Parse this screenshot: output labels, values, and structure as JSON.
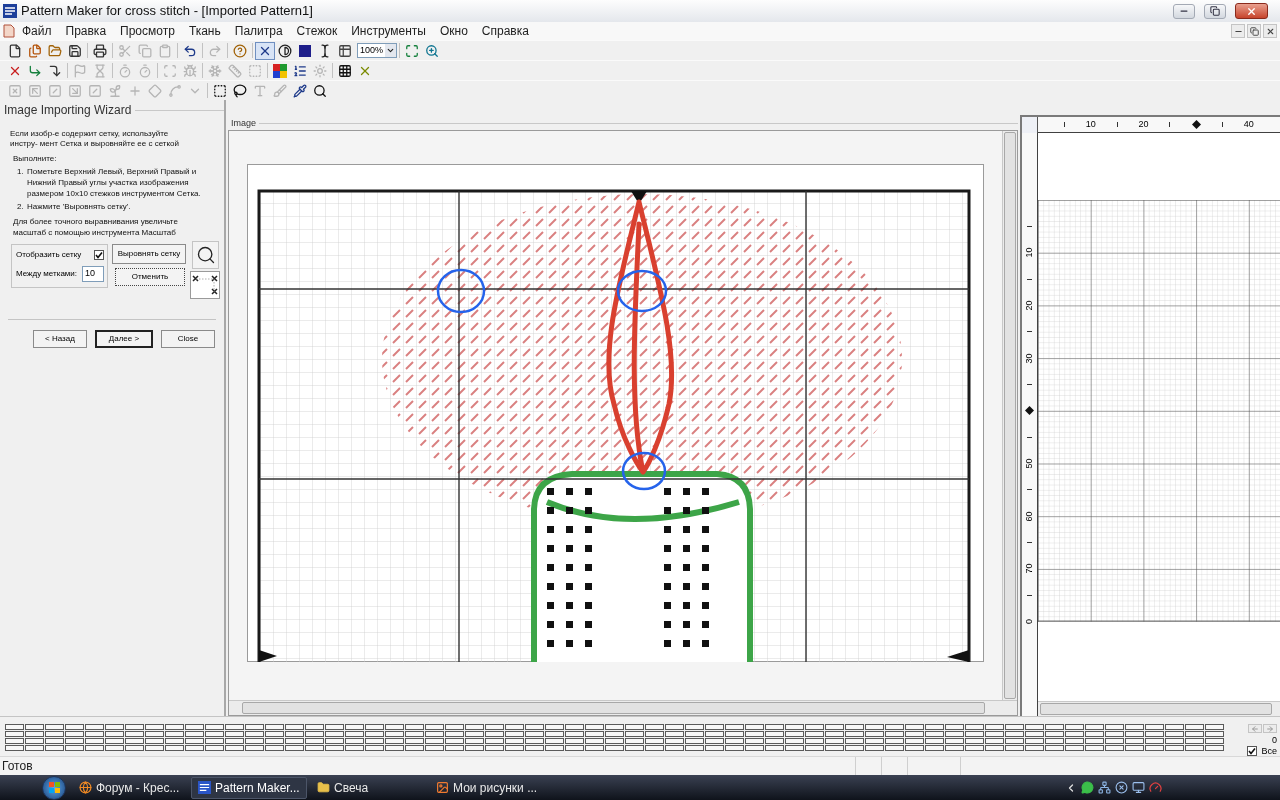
{
  "window": {
    "title": "Pattern Maker for cross stitch - [Imported Pattern1]"
  },
  "menu": [
    "Файл",
    "Правка",
    "Просмотр",
    "Ткань",
    "Палитра",
    "Стежок",
    "Инструменты",
    "Окно",
    "Справка"
  ],
  "toolbars": [
    {
      "groups": [
        [
          {
            "kind": "button",
            "disabled": false,
            "pressed": false
          },
          {
            "kind": "button",
            "disabled": false,
            "pressed": false
          },
          {
            "kind": "button",
            "disabled": false,
            "pressed": false
          },
          {
            "kind": "button",
            "disabled": false,
            "pressed": false
          }
        ],
        [
          {
            "kind": "button",
            "disabled": false,
            "pressed": false
          }
        ],
        [
          {
            "kind": "button",
            "disabled": true,
            "pressed": false
          },
          {
            "kind": "button",
            "disabled": true,
            "pressed": false
          },
          {
            "kind": "button",
            "disabled": true,
            "pressed": false
          }
        ],
        [
          {
            "kind": "button",
            "disabled": false,
            "pressed": false
          }
        ],
        [
          {
            "kind": "button",
            "disabled": true,
            "pressed": false
          }
        ],
        [
          {
            "kind": "button",
            "disabled": false,
            "pressed": false
          }
        ],
        [
          {
            "kind": "button",
            "disabled": false,
            "pressed": true
          },
          {
            "kind": "button",
            "disabled": false,
            "pressed": false
          },
          {
            "kind": "button",
            "disabled": false,
            "pressed": false
          },
          {
            "kind": "button",
            "disabled": false,
            "pressed": false
          },
          {
            "kind": "button",
            "disabled": false,
            "pressed": false
          },
          {
            "kind": "combo",
            "value": "100%"
          }
        ],
        [
          {
            "kind": "button",
            "disabled": false,
            "pressed": false
          },
          {
            "kind": "button",
            "disabled": false,
            "pressed": false
          }
        ]
      ]
    },
    {
      "groups": [
        [
          {
            "kind": "button",
            "disabled": false,
            "pressed": false
          },
          {
            "kind": "button",
            "disabled": false,
            "pressed": false
          },
          {
            "kind": "button",
            "disabled": false,
            "pressed": false
          }
        ],
        [
          {
            "kind": "button",
            "disabled": true,
            "pressed": false
          },
          {
            "kind": "button",
            "disabled": true,
            "pressed": false
          }
        ],
        [
          {
            "kind": "button",
            "disabled": true,
            "pressed": false
          },
          {
            "kind": "button",
            "disabled": true,
            "pressed": false
          }
        ],
        [
          {
            "kind": "button",
            "disabled": true,
            "pressed": false
          },
          {
            "kind": "button",
            "disabled": true,
            "pressed": false
          }
        ],
        [
          {
            "kind": "button",
            "disabled": true,
            "pressed": false
          },
          {
            "kind": "button",
            "disabled": true,
            "pressed": false
          },
          {
            "kind": "button",
            "disabled": true,
            "pressed": false
          }
        ],
        [
          {
            "kind": "button",
            "disabled": false,
            "pressed": false
          },
          {
            "kind": "button",
            "disabled": false,
            "pressed": false
          },
          {
            "kind": "button",
            "disabled": true,
            "pressed": false
          }
        ],
        [
          {
            "kind": "button",
            "disabled": false,
            "pressed": false
          },
          {
            "kind": "button",
            "disabled": false,
            "pressed": false
          }
        ]
      ]
    },
    {
      "groups": [
        [
          {
            "kind": "button",
            "disabled": true,
            "pressed": false
          },
          {
            "kind": "button",
            "disabled": true,
            "pressed": false
          },
          {
            "kind": "button",
            "disabled": true,
            "pressed": false
          },
          {
            "kind": "button",
            "disabled": true,
            "pressed": false
          },
          {
            "kind": "button",
            "disabled": true,
            "pressed": false
          },
          {
            "kind": "button",
            "disabled": true,
            "pressed": false
          },
          {
            "kind": "button",
            "disabled": true,
            "pressed": false
          },
          {
            "kind": "button",
            "disabled": true,
            "pressed": false
          },
          {
            "kind": "button",
            "disabled": true,
            "pressed": false
          },
          {
            "kind": "button",
            "disabled": true,
            "pressed": false
          }
        ],
        [
          {
            "kind": "button",
            "disabled": false,
            "pressed": false
          },
          {
            "kind": "button",
            "disabled": false,
            "pressed": false
          },
          {
            "kind": "button",
            "disabled": true,
            "pressed": false
          },
          {
            "kind": "button",
            "disabled": true,
            "pressed": false
          },
          {
            "kind": "button",
            "disabled": false,
            "pressed": false
          },
          {
            "kind": "button",
            "disabled": false,
            "pressed": false
          }
        ]
      ]
    }
  ],
  "wizard": {
    "title": "Image Importing Wizard",
    "intro": "Если изобр-е содержит сетку, используйте инстру- мент Сетка и выровняйте ее с сеткой",
    "steps_heading": "Выполните:",
    "steps": [
      {
        "number": "1.",
        "text": "Пометьте Верхний Левый, Верхний Правый и Нижний Правый углы участка изображения размером 10x10 стежков инструментом Сетка."
      },
      {
        "number": "2.",
        "text": "Нажмите 'Выровнять сетку'."
      }
    ],
    "tip": "Для более точного выравнивания увеличьте масштаб с помощью инструмента Масштаб",
    "show_grid": {
      "label": "Отобразить сетку",
      "checked": true
    },
    "spacing": {
      "label": "Между метками:",
      "value": "10"
    },
    "align_button": "Выровнять сетку",
    "cancel_button": "Отменить",
    "nav_buttons": [
      {
        "label": "< Назад",
        "default": false
      },
      {
        "label": "Далее >",
        "default": true
      },
      {
        "label": "Close",
        "default": false
      }
    ]
  },
  "image_panel": {
    "title": "Image"
  },
  "rulers": {
    "top": [
      {
        "kind": "label",
        "text": "10"
      },
      {
        "kind": "label",
        "text": "20"
      },
      {
        "kind": "marker"
      },
      {
        "kind": "label",
        "text": "40"
      }
    ],
    "left": [
      {
        "kind": "label",
        "text": "10"
      },
      {
        "kind": "label",
        "text": "20"
      },
      {
        "kind": "label",
        "text": "30"
      },
      {
        "kind": "marker"
      },
      {
        "kind": "label",
        "text": "50"
      },
      {
        "kind": "label",
        "text": "60"
      },
      {
        "kind": "label",
        "text": "70"
      },
      {
        "kind": "label",
        "text": "0"
      }
    ]
  },
  "palette": {
    "counter": "0",
    "select_all": {
      "label": "Все",
      "checked": true
    }
  },
  "status_bar": {
    "text": "Готов"
  },
  "taskbar": {
    "tasks": [
      {
        "label": "Форум - Крес...",
        "selected": false
      },
      {
        "label": "Pattern Maker...",
        "selected": true
      },
      {
        "label": "Свеча",
        "selected": false
      },
      {
        "label": "Мои рисунки ...",
        "selected": false
      }
    ]
  }
}
